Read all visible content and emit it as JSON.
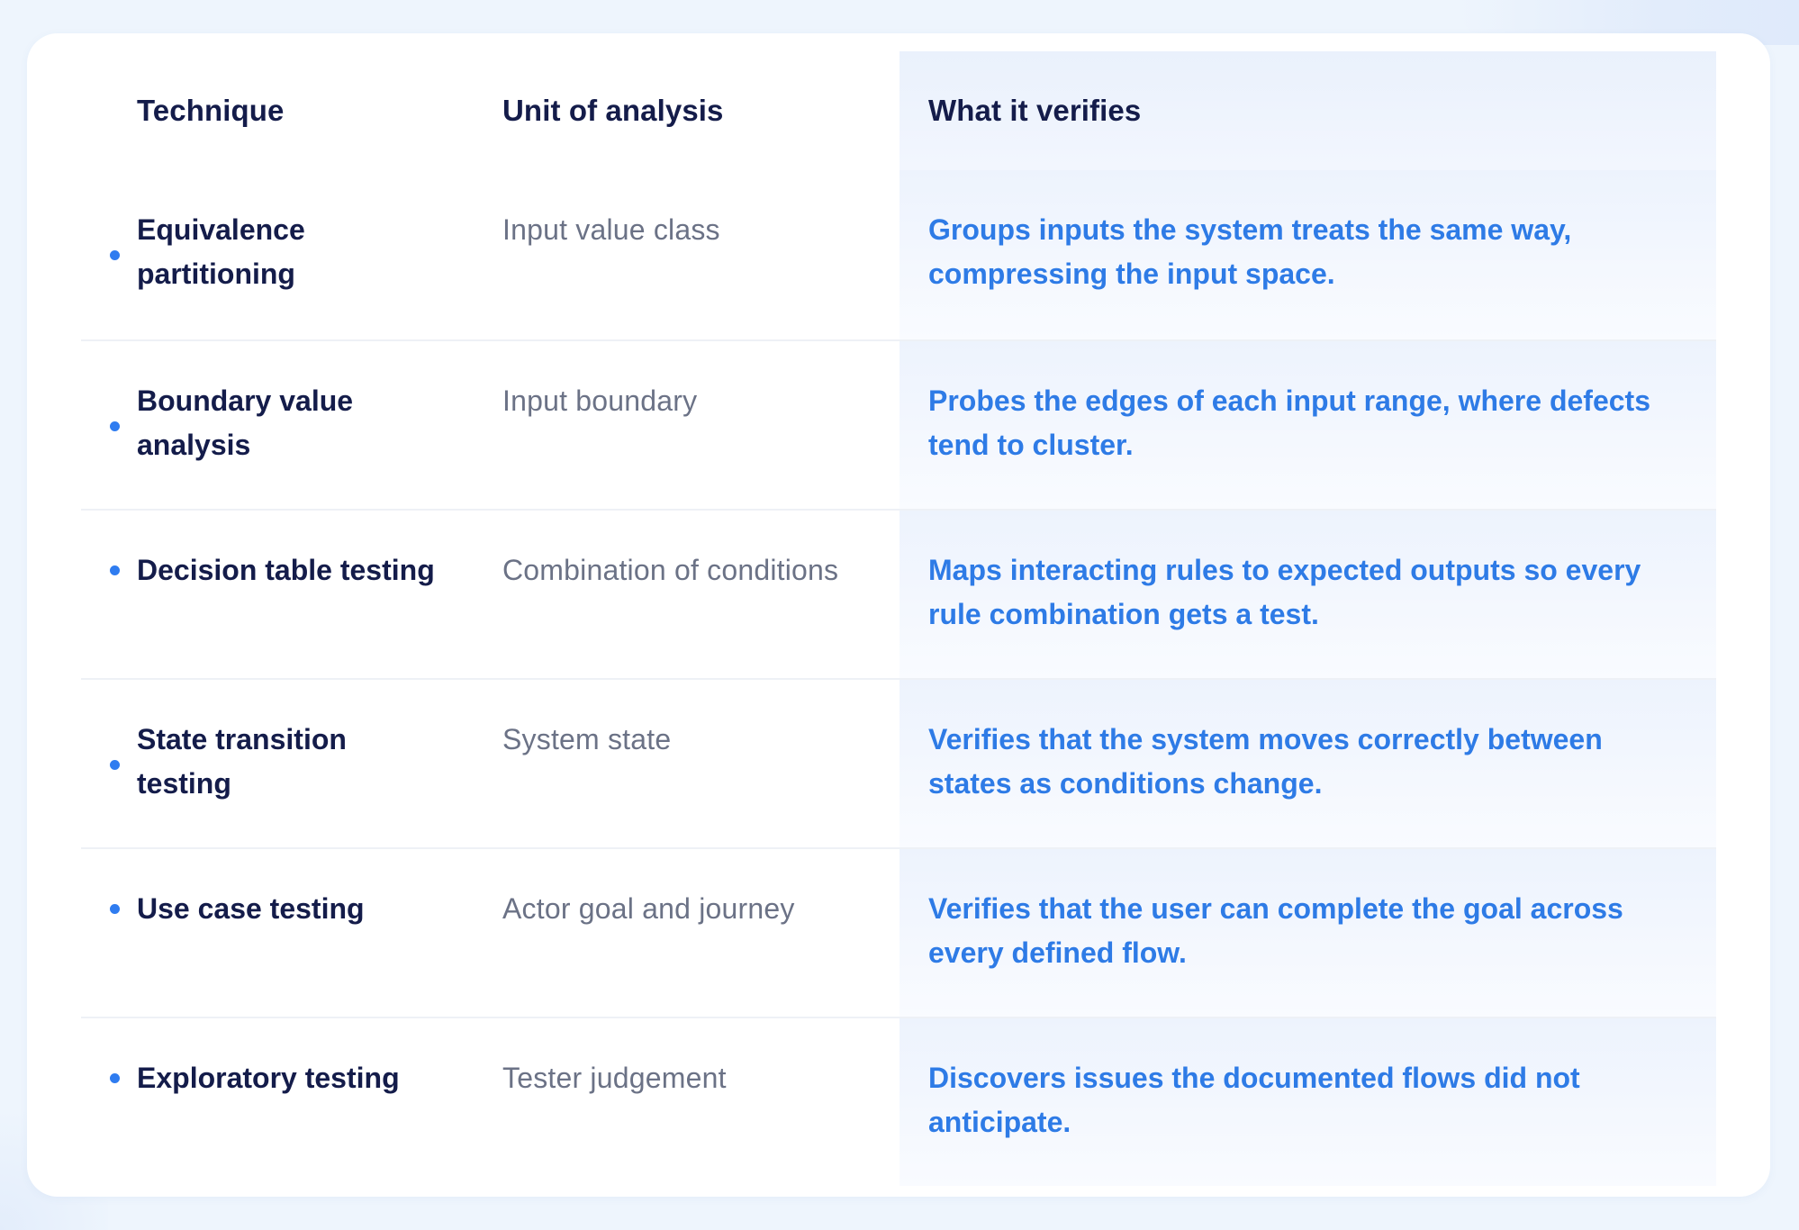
{
  "table": {
    "headers": {
      "technique": "Technique",
      "unit": "Unit of analysis",
      "verifies": "What it verifies"
    },
    "rows": [
      {
        "technique": "Equivalence partitioning",
        "unit": "Input value class",
        "verifies": "Groups inputs the system treats the same way, compressing the input space."
      },
      {
        "technique": "Boundary value analysis",
        "unit": "Input boundary",
        "verifies": "Probes the edges of each input range, where defects tend to cluster."
      },
      {
        "technique": "Decision table testing",
        "unit": "Combination of conditions",
        "verifies": "Maps interacting rules to expected outputs so every rule combination gets a test."
      },
      {
        "technique": "State transition testing",
        "unit": "System state",
        "verifies": "Verifies that the system moves correctly between states as conditions change."
      },
      {
        "technique": "Use case testing",
        "unit": "Actor goal and journey",
        "verifies": "Verifies that the user can complete the goal across every defined flow."
      },
      {
        "technique": "Exploratory testing",
        "unit": "Tester judgement",
        "verifies": "Discovers issues the documented flows did not anticipate."
      }
    ]
  },
  "colors": {
    "heading": "#141c4a",
    "muted": "#6b7286",
    "accent": "#2e7be6",
    "bullet": "#2f7cf0"
  }
}
